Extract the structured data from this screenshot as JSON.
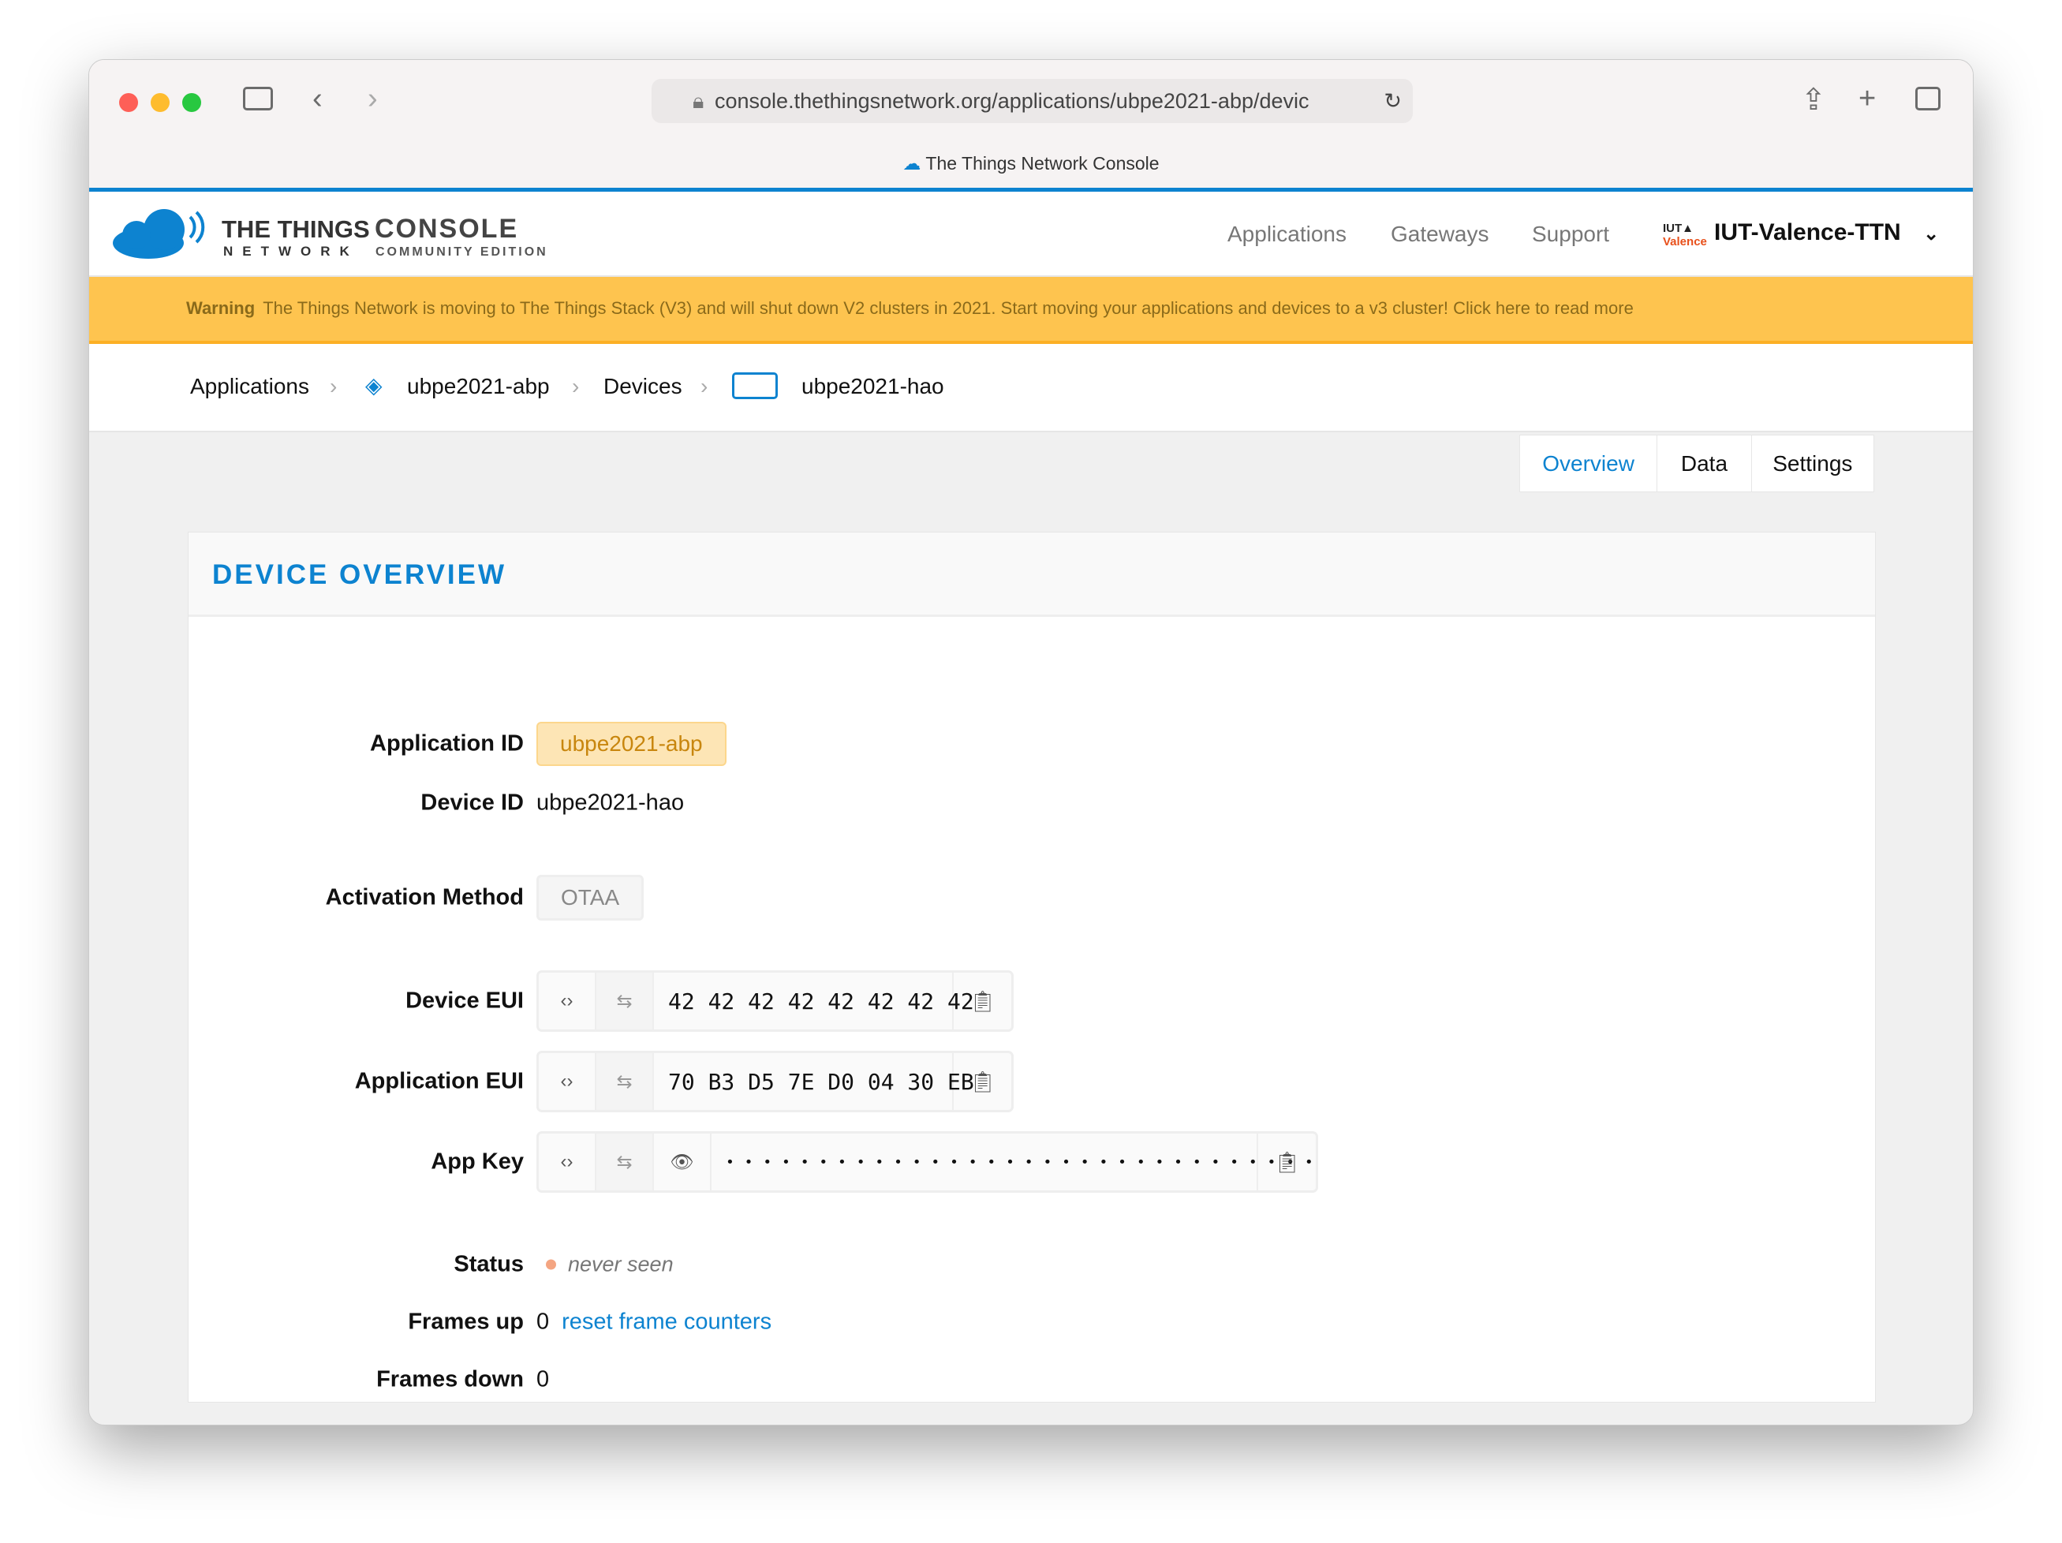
{
  "browser": {
    "url": "console.thethingsnetwork.org/applications/ubpe2021-abp/devic",
    "tab_title": "The Things Network Console"
  },
  "header": {
    "logo_line1": "THE THINGS",
    "logo_line2": "NETWORK",
    "logo_console": "CONSOLE",
    "logo_edition": "COMMUNITY EDITION",
    "nav": [
      "Applications",
      "Gateways",
      "Support"
    ],
    "user": "IUT-Valence-TTN",
    "org_logo_text": "IUT Valence"
  },
  "warning": {
    "label": "Warning",
    "text": "The Things Network is moving to The Things Stack (V3) and will shut down V2 clusters in 2021. Start moving your applications and devices to a v3 cluster! Click here to read more"
  },
  "breadcrumb": [
    "Applications",
    "ubpe2021-abp",
    "Devices",
    "ubpe2021-hao"
  ],
  "tabs": [
    "Overview",
    "Data",
    "Settings"
  ],
  "card": {
    "title": "DEVICE OVERVIEW",
    "fields": {
      "app_id_label": "Application ID",
      "app_id": "ubpe2021-abp",
      "device_id_label": "Device ID",
      "device_id": "ubpe2021-hao",
      "activation_label": "Activation Method",
      "activation": "OTAA",
      "dev_eui_label": "Device EUI",
      "dev_eui": "42 42 42 42 42 42 42 42",
      "app_eui_label": "Application EUI",
      "app_eui": "70 B3 D5 7E D0 04 30 EB",
      "app_key_label": "App Key",
      "app_key": "• • • • • • • • • • • • • • • • • • • • • • • • • • • • • • • •",
      "status_label": "Status",
      "status": "never seen",
      "frames_up_label": "Frames up",
      "frames_up": "0",
      "reset_link": "reset frame counters",
      "frames_down_label": "Frames down",
      "frames_down": "0"
    }
  },
  "colors": {
    "accent": "#0d83d0",
    "warning": "#fec44f",
    "status_dot": "#f4a582"
  }
}
